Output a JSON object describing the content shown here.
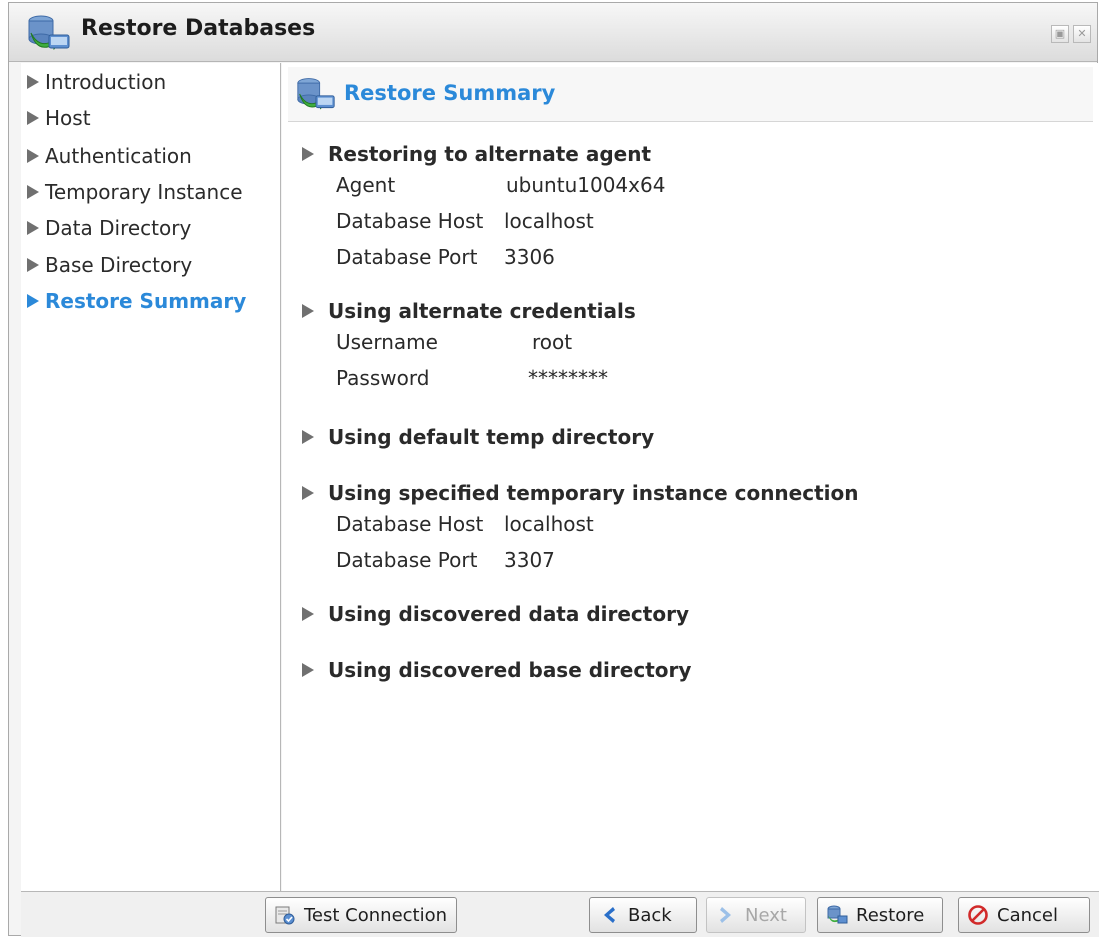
{
  "window": {
    "title": "Restore Databases"
  },
  "sidebar": {
    "items": [
      {
        "label": "Introduction",
        "active": false
      },
      {
        "label": "Host",
        "active": false
      },
      {
        "label": "Authentication",
        "active": false
      },
      {
        "label": "Temporary Instance",
        "active": false
      },
      {
        "label": "Data Directory",
        "active": false
      },
      {
        "label": "Base Directory",
        "active": false
      },
      {
        "label": "Restore Summary",
        "active": true
      }
    ]
  },
  "main": {
    "header_title": "Restore Summary",
    "sections": [
      {
        "heading": "Restoring to alternate agent",
        "rows": [
          {
            "key": "Agent",
            "value": "ubuntu1004x64"
          },
          {
            "key": "Database Host",
            "value": "localhost"
          },
          {
            "key": "Database Port",
            "value": "3306"
          }
        ]
      },
      {
        "heading": "Using alternate credentials",
        "rows": [
          {
            "key": "Username",
            "value": "root"
          },
          {
            "key": "Password",
            "value": "********"
          }
        ]
      },
      {
        "heading": "Using default temp directory",
        "rows": []
      },
      {
        "heading": "Using specified temporary instance connection",
        "rows": [
          {
            "key": "Database Host",
            "value": "localhost"
          },
          {
            "key": "Database Port",
            "value": "3307"
          }
        ]
      },
      {
        "heading": "Using discovered data directory",
        "rows": []
      },
      {
        "heading": "Using discovered base directory",
        "rows": []
      }
    ]
  },
  "footer": {
    "test_connection": "Test Connection",
    "back": "Back",
    "next": "Next",
    "restore": "Restore",
    "cancel": "Cancel"
  },
  "colors": {
    "accent": "#2b89d9",
    "text": "#2a2a2a",
    "disabled_text": "#a7a7a7"
  },
  "icons": {
    "window": "database-restore-icon",
    "section_bullet": "triangle-right-icon",
    "back": "chevron-left-icon",
    "next": "chevron-right-icon",
    "restore": "database-restore-icon",
    "cancel": "no-entry-icon",
    "test_connection": "connection-test-icon"
  }
}
